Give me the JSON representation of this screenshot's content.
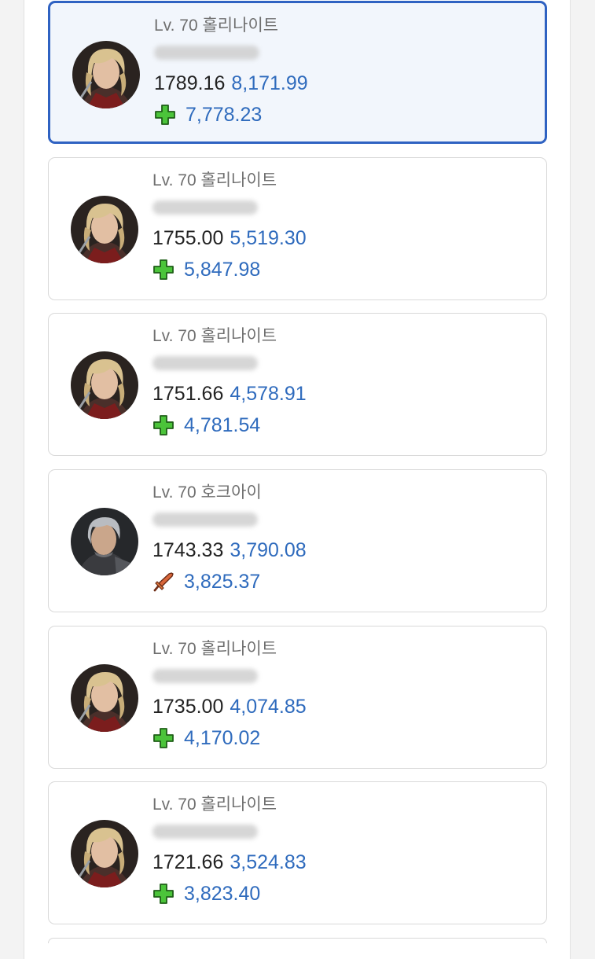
{
  "colors": {
    "accent": "#2f62c2",
    "score_text": "#2f6bbd",
    "support_icon": "#4bc43a",
    "dps_icon": "#c4532c"
  },
  "characters": [
    {
      "level": "Lv. 70 홀리나이트",
      "item_level": "1789.16",
      "score": "8,171.99",
      "role_icon": "green-cross-icon",
      "role_score": "7,778.23",
      "selected": true
    },
    {
      "level": "Lv. 70 홀리나이트",
      "item_level": "1755.00",
      "score": "5,519.30",
      "role_icon": "green-cross-icon",
      "role_score": "5,847.98",
      "selected": false
    },
    {
      "level": "Lv. 70 홀리나이트",
      "item_level": "1751.66",
      "score": "4,578.91",
      "role_icon": "green-cross-icon",
      "role_score": "4,781.54",
      "selected": false
    },
    {
      "level": "Lv. 70 호크아이",
      "item_level": "1743.33",
      "score": "3,790.08",
      "role_icon": "sword-icon",
      "role_score": "3,825.37",
      "selected": false
    },
    {
      "level": "Lv. 70 홀리나이트",
      "item_level": "1735.00",
      "score": "4,074.85",
      "role_icon": "green-cross-icon",
      "role_score": "4,170.02",
      "selected": false
    },
    {
      "level": "Lv. 70 홀리나이트",
      "item_level": "1721.66",
      "score": "3,524.83",
      "role_icon": "green-cross-icon",
      "role_score": "3,823.40",
      "selected": false
    }
  ]
}
